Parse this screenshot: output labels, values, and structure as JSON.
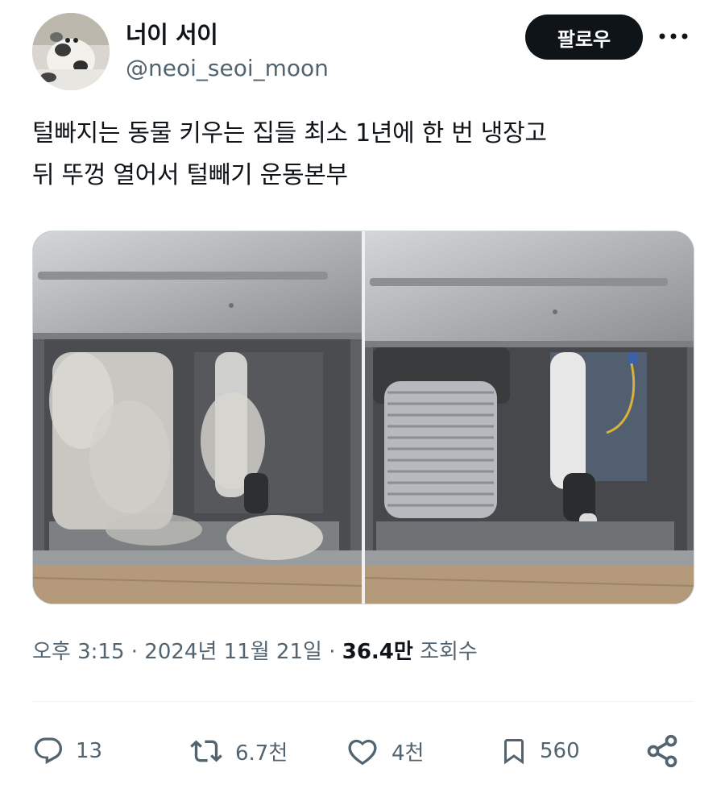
{
  "author": {
    "display_name": "너이 서이",
    "handle": "@neoi_seoi_moon",
    "avatar_icon": "cat-avatar"
  },
  "header": {
    "follow_label": "팔로우",
    "more_icon": "ellipsis-icon"
  },
  "tweet": {
    "text_lines": [
      "털빠지는 동물 키우는 집들 최소 1년에 한 번 냉장고",
      "뒤 뚜껑 열어서 털빼기 운동본부"
    ]
  },
  "media": {
    "photos": [
      {
        "icon": "refrigerator-back-dusty-photo"
      },
      {
        "icon": "refrigerator-back-clean-photo"
      }
    ]
  },
  "meta": {
    "time": "오후 3:15",
    "separator": "·",
    "date": "2024년 11월 21일",
    "separator2": "·",
    "views_count": "36.4만",
    "views_label": "조회수"
  },
  "actions": {
    "reply_count": "13",
    "retweet_count": "6.7천",
    "like_count": "4천",
    "bookmark_count": "560"
  },
  "colors": {
    "text": "#0f1419",
    "secondary": "#536471",
    "divider": "#eff3f4",
    "button_bg": "#0f1419"
  }
}
